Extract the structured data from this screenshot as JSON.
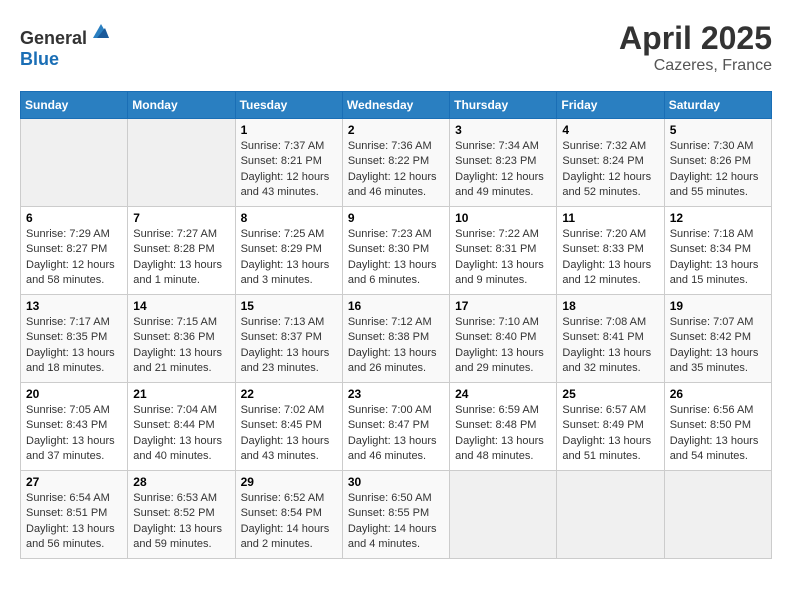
{
  "header": {
    "logo_general": "General",
    "logo_blue": "Blue",
    "month": "April 2025",
    "location": "Cazeres, France"
  },
  "weekdays": [
    "Sunday",
    "Monday",
    "Tuesday",
    "Wednesday",
    "Thursday",
    "Friday",
    "Saturday"
  ],
  "weeks": [
    [
      {
        "day": "",
        "info": ""
      },
      {
        "day": "",
        "info": ""
      },
      {
        "day": "1",
        "info": "Sunrise: 7:37 AM\nSunset: 8:21 PM\nDaylight: 12 hours and 43 minutes."
      },
      {
        "day": "2",
        "info": "Sunrise: 7:36 AM\nSunset: 8:22 PM\nDaylight: 12 hours and 46 minutes."
      },
      {
        "day": "3",
        "info": "Sunrise: 7:34 AM\nSunset: 8:23 PM\nDaylight: 12 hours and 49 minutes."
      },
      {
        "day": "4",
        "info": "Sunrise: 7:32 AM\nSunset: 8:24 PM\nDaylight: 12 hours and 52 minutes."
      },
      {
        "day": "5",
        "info": "Sunrise: 7:30 AM\nSunset: 8:26 PM\nDaylight: 12 hours and 55 minutes."
      }
    ],
    [
      {
        "day": "6",
        "info": "Sunrise: 7:29 AM\nSunset: 8:27 PM\nDaylight: 12 hours and 58 minutes."
      },
      {
        "day": "7",
        "info": "Sunrise: 7:27 AM\nSunset: 8:28 PM\nDaylight: 13 hours and 1 minute."
      },
      {
        "day": "8",
        "info": "Sunrise: 7:25 AM\nSunset: 8:29 PM\nDaylight: 13 hours and 3 minutes."
      },
      {
        "day": "9",
        "info": "Sunrise: 7:23 AM\nSunset: 8:30 PM\nDaylight: 13 hours and 6 minutes."
      },
      {
        "day": "10",
        "info": "Sunrise: 7:22 AM\nSunset: 8:31 PM\nDaylight: 13 hours and 9 minutes."
      },
      {
        "day": "11",
        "info": "Sunrise: 7:20 AM\nSunset: 8:33 PM\nDaylight: 13 hours and 12 minutes."
      },
      {
        "day": "12",
        "info": "Sunrise: 7:18 AM\nSunset: 8:34 PM\nDaylight: 13 hours and 15 minutes."
      }
    ],
    [
      {
        "day": "13",
        "info": "Sunrise: 7:17 AM\nSunset: 8:35 PM\nDaylight: 13 hours and 18 minutes."
      },
      {
        "day": "14",
        "info": "Sunrise: 7:15 AM\nSunset: 8:36 PM\nDaylight: 13 hours and 21 minutes."
      },
      {
        "day": "15",
        "info": "Sunrise: 7:13 AM\nSunset: 8:37 PM\nDaylight: 13 hours and 23 minutes."
      },
      {
        "day": "16",
        "info": "Sunrise: 7:12 AM\nSunset: 8:38 PM\nDaylight: 13 hours and 26 minutes."
      },
      {
        "day": "17",
        "info": "Sunrise: 7:10 AM\nSunset: 8:40 PM\nDaylight: 13 hours and 29 minutes."
      },
      {
        "day": "18",
        "info": "Sunrise: 7:08 AM\nSunset: 8:41 PM\nDaylight: 13 hours and 32 minutes."
      },
      {
        "day": "19",
        "info": "Sunrise: 7:07 AM\nSunset: 8:42 PM\nDaylight: 13 hours and 35 minutes."
      }
    ],
    [
      {
        "day": "20",
        "info": "Sunrise: 7:05 AM\nSunset: 8:43 PM\nDaylight: 13 hours and 37 minutes."
      },
      {
        "day": "21",
        "info": "Sunrise: 7:04 AM\nSunset: 8:44 PM\nDaylight: 13 hours and 40 minutes."
      },
      {
        "day": "22",
        "info": "Sunrise: 7:02 AM\nSunset: 8:45 PM\nDaylight: 13 hours and 43 minutes."
      },
      {
        "day": "23",
        "info": "Sunrise: 7:00 AM\nSunset: 8:47 PM\nDaylight: 13 hours and 46 minutes."
      },
      {
        "day": "24",
        "info": "Sunrise: 6:59 AM\nSunset: 8:48 PM\nDaylight: 13 hours and 48 minutes."
      },
      {
        "day": "25",
        "info": "Sunrise: 6:57 AM\nSunset: 8:49 PM\nDaylight: 13 hours and 51 minutes."
      },
      {
        "day": "26",
        "info": "Sunrise: 6:56 AM\nSunset: 8:50 PM\nDaylight: 13 hours and 54 minutes."
      }
    ],
    [
      {
        "day": "27",
        "info": "Sunrise: 6:54 AM\nSunset: 8:51 PM\nDaylight: 13 hours and 56 minutes."
      },
      {
        "day": "28",
        "info": "Sunrise: 6:53 AM\nSunset: 8:52 PM\nDaylight: 13 hours and 59 minutes."
      },
      {
        "day": "29",
        "info": "Sunrise: 6:52 AM\nSunset: 8:54 PM\nDaylight: 14 hours and 2 minutes."
      },
      {
        "day": "30",
        "info": "Sunrise: 6:50 AM\nSunset: 8:55 PM\nDaylight: 14 hours and 4 minutes."
      },
      {
        "day": "",
        "info": ""
      },
      {
        "day": "",
        "info": ""
      },
      {
        "day": "",
        "info": ""
      }
    ]
  ]
}
